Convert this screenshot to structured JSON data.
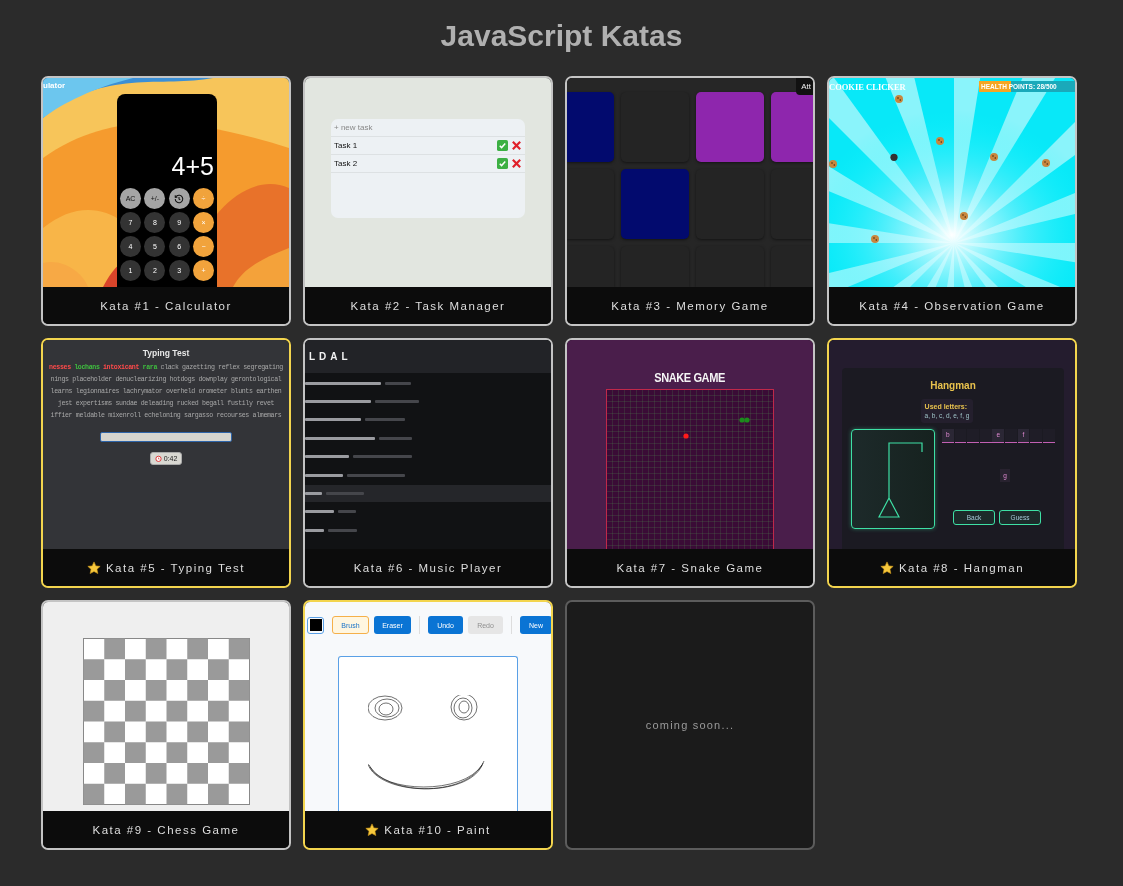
{
  "page": {
    "title": "JavaScript Katas"
  },
  "cards": [
    {
      "kind": "kata",
      "caption": "Kata #1 - Calculator",
      "starred": false,
      "preview": {
        "kind": "calculator",
        "window_title": "ulator",
        "display": "4+5",
        "keys": [
          {
            "label": "AC",
            "kind": "function"
          },
          {
            "label": "+/-",
            "kind": "function"
          },
          {
            "kind": "function"
          },
          {
            "label": "÷",
            "kind": "operator"
          },
          {
            "label": "7",
            "kind": "digit"
          },
          {
            "label": "8",
            "kind": "digit"
          },
          {
            "label": "9",
            "kind": "digit"
          },
          {
            "label": "×",
            "kind": "operator"
          },
          {
            "label": "4",
            "kind": "digit"
          },
          {
            "label": "5",
            "kind": "digit"
          },
          {
            "label": "6",
            "kind": "digit"
          },
          {
            "label": "−",
            "kind": "operator"
          },
          {
            "label": "1",
            "kind": "digit"
          },
          {
            "label": "2",
            "kind": "digit"
          },
          {
            "label": "3",
            "kind": "digit"
          },
          {
            "label": "+",
            "kind": "operator"
          }
        ]
      }
    },
    {
      "kind": "kata",
      "caption": "Kata #2 - Task Manager",
      "starred": false,
      "preview": {
        "kind": "tasks",
        "placeholder": "+ new task",
        "tasks": [
          {
            "name": "Task 1"
          },
          {
            "name": "Task 2"
          }
        ]
      }
    },
    {
      "kind": "kata",
      "caption": "Kata #3 - Memory Game",
      "starred": false,
      "preview": {
        "kind": "memory",
        "badge": "Att",
        "tiles": [
          {
            "color": "#020a6e"
          },
          {
            "color": "#242424"
          },
          {
            "color": "#8e26ad"
          },
          {
            "color": "#8e26ad"
          },
          {
            "color": "#242424"
          },
          {
            "color": "#020a6e"
          },
          {
            "color": "#242424"
          },
          {
            "color": "#242424"
          },
          {
            "color": "#242424"
          },
          {
            "color": "#242424"
          },
          {
            "color": "#242424"
          },
          {
            "color": "#242424"
          }
        ]
      }
    },
    {
      "kind": "kata",
      "caption": "Kata #4 - Observation Game",
      "starred": false,
      "preview": {
        "kind": "cookies",
        "title": "COOKIE CLICKER",
        "health": {
          "label": "HEALTH POINTS: 28/500",
          "level": 0.33
        }
      }
    },
    {
      "kind": "kata",
      "caption": "Kata #5 - Typing Test",
      "starred": true,
      "preview": {
        "kind": "typing",
        "title": "Typing Test",
        "words": [
          {
            "text": "nesses",
            "typed": true,
            "correct": false
          },
          {
            "text": "lochans",
            "typed": true,
            "correct": true
          },
          {
            "text": "intoxicant",
            "typed": true,
            "correct": false
          },
          {
            "text": "rara",
            "typed": true,
            "correct": true
          },
          {
            "text": "clack",
            "typed": false
          },
          {
            "text": "gazetting",
            "typed": false
          },
          {
            "text": "reflex",
            "typed": false
          },
          {
            "text": "segregating",
            "typed": false
          }
        ],
        "lines": [
          "nings placeholder denuclearizing hotdogs downplay gerontological",
          "learns legionnaires lachrymator overheld orometer blunts earthen",
          "jest expertisms sundae deleading rucked begall fustily revet",
          "iffier meldable mixenroll echeloning sargasso recourses almemars"
        ],
        "timer": "0:42"
      }
    },
    {
      "kind": "kata",
      "caption": "Kata #6 - Music Player",
      "starred": false,
      "preview": {
        "kind": "music",
        "header": "LDAL",
        "tracks": [
          {
            "selected": false
          },
          {
            "selected": false
          },
          {
            "selected": false
          },
          {
            "selected": false
          },
          {
            "selected": false
          },
          {
            "selected": false
          },
          {
            "selected": true
          },
          {
            "selected": false
          },
          {
            "selected": false
          }
        ]
      }
    },
    {
      "kind": "kata",
      "caption": "Kata #7 - Snake Game",
      "starred": false,
      "preview": {
        "kind": "snake",
        "title": "SNAKE GAME"
      }
    },
    {
      "kind": "kata",
      "caption": "Kata #8 - Hangman",
      "starred": true,
      "preview": {
        "kind": "hangman",
        "title": "Hangman",
        "used_label": "Used letters:",
        "used": "a, b, c, d, e, f, g",
        "slots": [
          {
            "filled": true,
            "letter": "b"
          },
          {
            "filled": false
          },
          {
            "filled": false
          },
          {
            "filled": false
          },
          {
            "filled": true,
            "letter": "e"
          },
          {
            "filled": false
          },
          {
            "filled": true,
            "letter": "f"
          },
          {
            "filled": false
          },
          {
            "filled": false
          }
        ],
        "guess": "g",
        "buttons": [
          "Back",
          "Guess"
        ]
      }
    },
    {
      "kind": "kata",
      "caption": "Kata #9 - Chess Game",
      "starred": false,
      "preview": {
        "kind": "chess"
      }
    },
    {
      "kind": "kata",
      "caption": "Kata #10 - Paint",
      "starred": true,
      "preview": {
        "kind": "paint",
        "color": "#000000",
        "tools": [
          {
            "label": "Brush",
            "selected": true
          },
          {
            "label": "Eraser",
            "selected": false
          }
        ],
        "actions": [
          {
            "label": "Undo",
            "disabled": false
          },
          {
            "label": "Redo",
            "disabled": true
          },
          {
            "label": "New",
            "disabled": false
          }
        ]
      }
    },
    {
      "kind": "placeholder",
      "text": "coming soon..."
    }
  ]
}
